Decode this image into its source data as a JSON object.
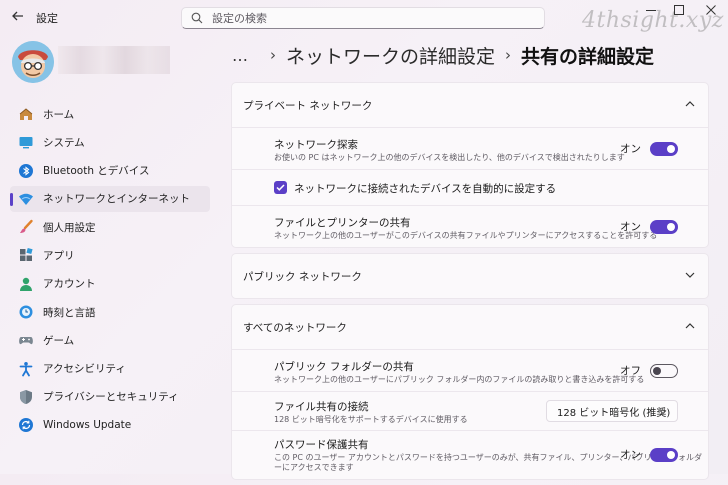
{
  "window": {
    "title": "設定",
    "back_icon": "back-arrow-icon",
    "controls": [
      "minimize-icon",
      "maximize-icon",
      "close-icon"
    ]
  },
  "search": {
    "placeholder": "設定の検索",
    "icon": "search-icon"
  },
  "watermark": "4thsight.xyz",
  "sidebar": {
    "items": [
      {
        "label": "ホーム",
        "icon": "home-icon",
        "active": false
      },
      {
        "label": "システム",
        "icon": "system-icon",
        "active": false
      },
      {
        "label": "Bluetooth とデバイス",
        "icon": "bluetooth-icon",
        "active": false
      },
      {
        "label": "ネットワークとインターネット",
        "icon": "network-icon",
        "active": true
      },
      {
        "label": "個人用設定",
        "icon": "personalization-brush-icon",
        "active": false
      },
      {
        "label": "アプリ",
        "icon": "apps-icon",
        "active": false
      },
      {
        "label": "アカウント",
        "icon": "account-icon",
        "active": false
      },
      {
        "label": "時刻と言語",
        "icon": "time-language-icon",
        "active": false
      },
      {
        "label": "ゲーム",
        "icon": "gaming-icon",
        "active": false
      },
      {
        "label": "アクセシビリティ",
        "icon": "accessibility-icon",
        "active": false
      },
      {
        "label": "プライバシーとセキュリティ",
        "icon": "shield-icon",
        "active": false
      },
      {
        "label": "Windows Update",
        "icon": "windows-update-icon",
        "active": false
      }
    ]
  },
  "breadcrumb": {
    "ellipsis": "…",
    "separator": "›",
    "parent": "ネットワークの詳細設定",
    "current": "共有の詳細設定"
  },
  "sections": {
    "private": {
      "title": "プライベート ネットワーク",
      "expanded": true,
      "network_discovery": {
        "title": "ネットワーク探索",
        "description": "お使いの PC はネットワーク上の他のデバイスを検出したり、他のデバイスで検出されたりします",
        "state_label": "オン",
        "on": true
      },
      "auto_setup": {
        "label": "ネットワークに接続されたデバイスを自動的に設定する",
        "checked": true
      },
      "file_printer_sharing": {
        "title": "ファイルとプリンターの共有",
        "description": "ネットワーク上の他のユーザーがこのデバイスの共有ファイルやプリンターにアクセスすることを許可する",
        "state_label": "オン",
        "on": true
      }
    },
    "public": {
      "title": "パブリック ネットワーク",
      "expanded": false
    },
    "all": {
      "title": "すべてのネットワーク",
      "expanded": true,
      "public_folder_sharing": {
        "title": "パブリック フォルダーの共有",
        "description": "ネットワーク上の他のユーザーにパブリック フォルダー内のファイルの読み取りと書き込みを許可する",
        "state_label": "オフ",
        "on": false
      },
      "file_sharing_connections": {
        "title": "ファイル共有の接続",
        "description": "128 ビット暗号化をサポートするデバイスに使用する",
        "selected": "128 ビット暗号化 (推奨)"
      },
      "password_protected_sharing": {
        "title": "パスワード保護共有",
        "description_line1": "この PC のユーザー アカウントとパスワードを持つユーザーのみが、共有ファイル、プリンター、パブリック フォルダ",
        "description_line2": "ーにアクセスできます",
        "state_label": "オン",
        "on": true
      }
    }
  },
  "colors": {
    "accent": "#5b3fc7",
    "window_bg": "#f4eef5",
    "card_bg": "#fbf9fb"
  }
}
